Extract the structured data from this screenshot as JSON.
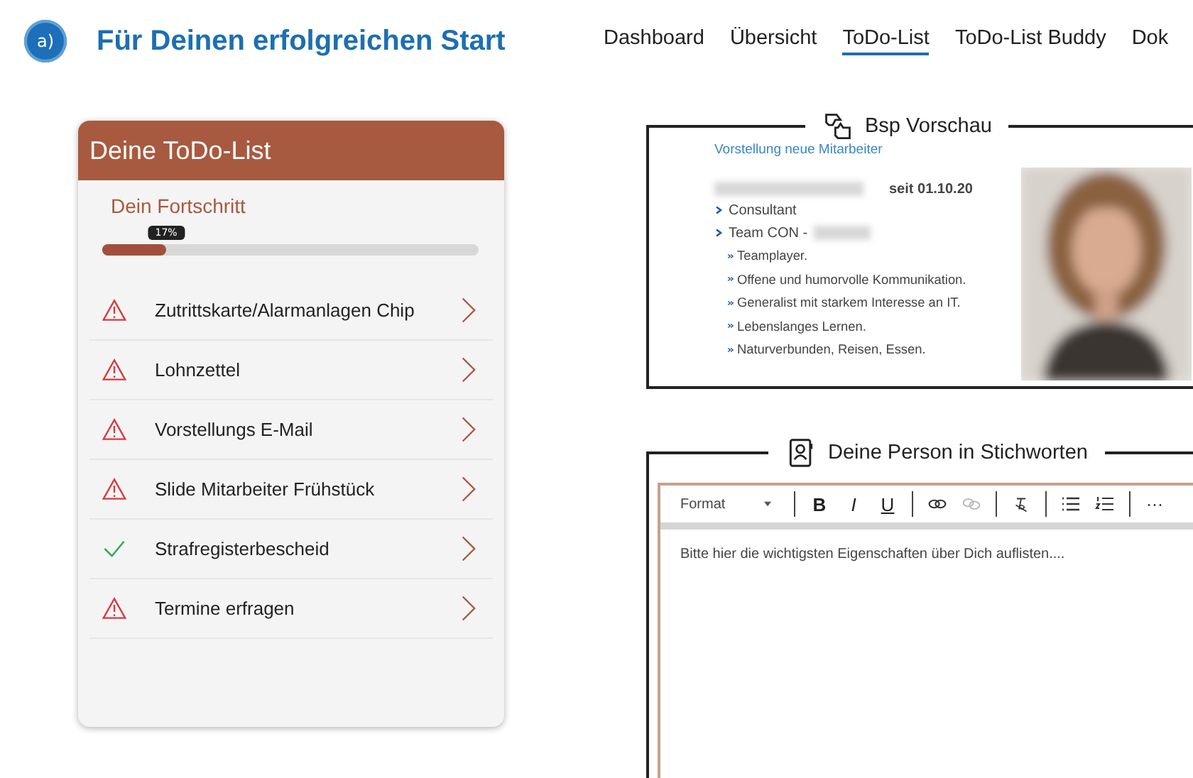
{
  "header": {
    "logo_letter": "a)",
    "title": "Für Deinen erfolgreichen Start"
  },
  "nav": [
    {
      "label": "Dashboard",
      "selected": false
    },
    {
      "label": "Übersicht",
      "selected": false
    },
    {
      "label": "ToDo-List",
      "selected": true
    },
    {
      "label": "ToDo-List Buddy",
      "selected": false
    },
    {
      "label": "Dok",
      "selected": false
    }
  ],
  "todo_card": {
    "title": "Deine ToDo-List",
    "progress_label": "Dein Fortschritt",
    "progress_badge": "17%",
    "level": 0.17,
    "items": [
      {
        "label": "Zutrittskarte/Alarmanlagen Chip",
        "done": false
      },
      {
        "label": "Lohnzettel",
        "done": false
      },
      {
        "label": "Vorstellungs E-Mail",
        "done": false
      },
      {
        "label": "Slide Mitarbeiter Frühstück",
        "done": false
      },
      {
        "label": "Strafregisterbescheid",
        "done": true
      },
      {
        "label": "Termine erfragen",
        "done": false
      }
    ]
  },
  "preview": {
    "legend": "Bsp Vorschau",
    "heading": "Vorstellung neue Mitarbeiter",
    "since": "seit 01.10.20",
    "facts": [
      "Consultant",
      "Team CON -"
    ],
    "traits": [
      "Teamplayer.",
      "Offene und humorvolle Kommunikation.",
      "Generalist mit starkem Interesse an IT.",
      "Lebenslanges Lernen.",
      "Naturverbunden, Reisen, Essen."
    ],
    "photo": {
      "kind": "picture"
    }
  },
  "keywords": {
    "legend": "Deine Person in Stichworten",
    "toolbar": {
      "format": "Format",
      "styles": [
        "B",
        "I",
        "U"
      ],
      "unlink_disabled": true,
      "more": "···"
    },
    "placeholder": "Bitte hier die wichtigsten Eigenschaften über Dich auflisten...."
  }
}
